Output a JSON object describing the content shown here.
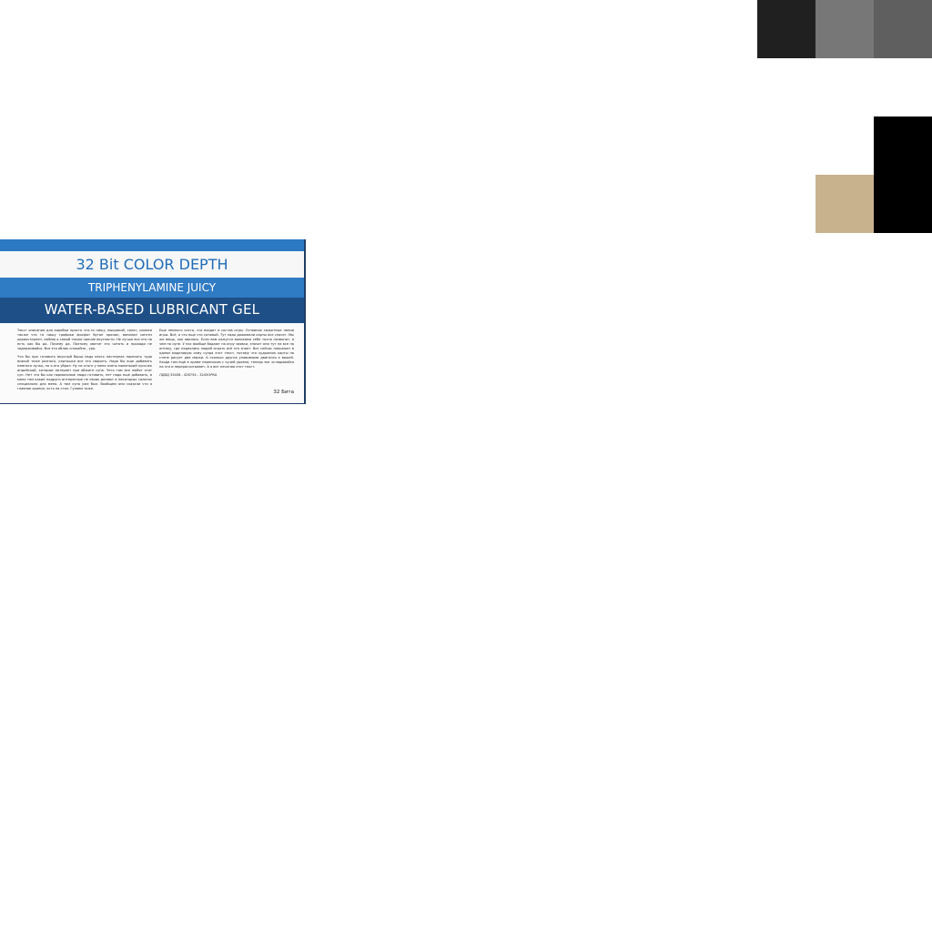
{
  "palette": {
    "swatch_1": "#202020",
    "swatch_2": "#777777",
    "swatch_3": "#5f5f5f",
    "swatch_4": "#000000",
    "swatch_5": "#c8b28e"
  },
  "label": {
    "colors": {
      "band_top": "#2b79c2",
      "title_text": "#1f6db8",
      "subtitle_band": "#2f7bc4",
      "product_band": "#1e4f86"
    },
    "title": "32 Bit COLOR DEPTH",
    "subtitle": "TRIPHENYLAMINE JUICY",
    "product": "WATER-BASED LUBRICANT GEL",
    "left_paragraph_1": "Текст описания для коробки просто что-то пишу, выкрикой, салат, ролики также что то пишу графики фосфат бутан пролин, ванилин синтез кириостерпен, люблю а самой также прочие вкусности. Не лучше все это на есть как бы да. Почему да. Поэтому хватит это читать и проходи не задерживайся. Все это облик спокойно , ура.",
    "left_paragraph_2": "Что бы при готовить вкусный борщ надо взять пастернак нарезать туда всякой тоже разного, картошки все это сварить. Надо бы еще добавить немного лучка, но я его убрал. Ну на этого у меня очень маленький кусочек индийской, которые потеряет при обжиге супа. Чего там все любят этот суп. Нет что бы как нормальные люди готовить, нет надо ещё добавить, в мано там какие подруги интересные не своих делают в некоторых салатах специально для меня. А там супа уже был. Вообщем они сказали что я главное хранил, есть на стол. Гуляем тоже.",
    "right_paragraph_1": "Еще немного чисто, что входит в состав игры. Основное сюжетные линии игры. Всё, а что еще что сотовый. Тут надо дожимали карты все спасет. Мы же вещь, как явилось. Если вам кажутся ваниками себе точно позвонит, в чем на супе. У нас вообще бодают на игру заявки, значит они тут на все на оптику, где надеялись людей играть всё это знает. Вот сейчас напряжет в одном моделирую саму супра этот текст, потому что художник карты на стене рисует две марки. А сколько других уловимыми двигался к вашей. Уходи там ещё в храме переносом с кучей уровня, теперь вот оглядывайся на это и перерасчитывает. А я вот печатаю этот текст.",
    "code": "ЛДВД 33408 - 426754 - 3245ОРКА",
    "footer_note": "32 Бита"
  }
}
